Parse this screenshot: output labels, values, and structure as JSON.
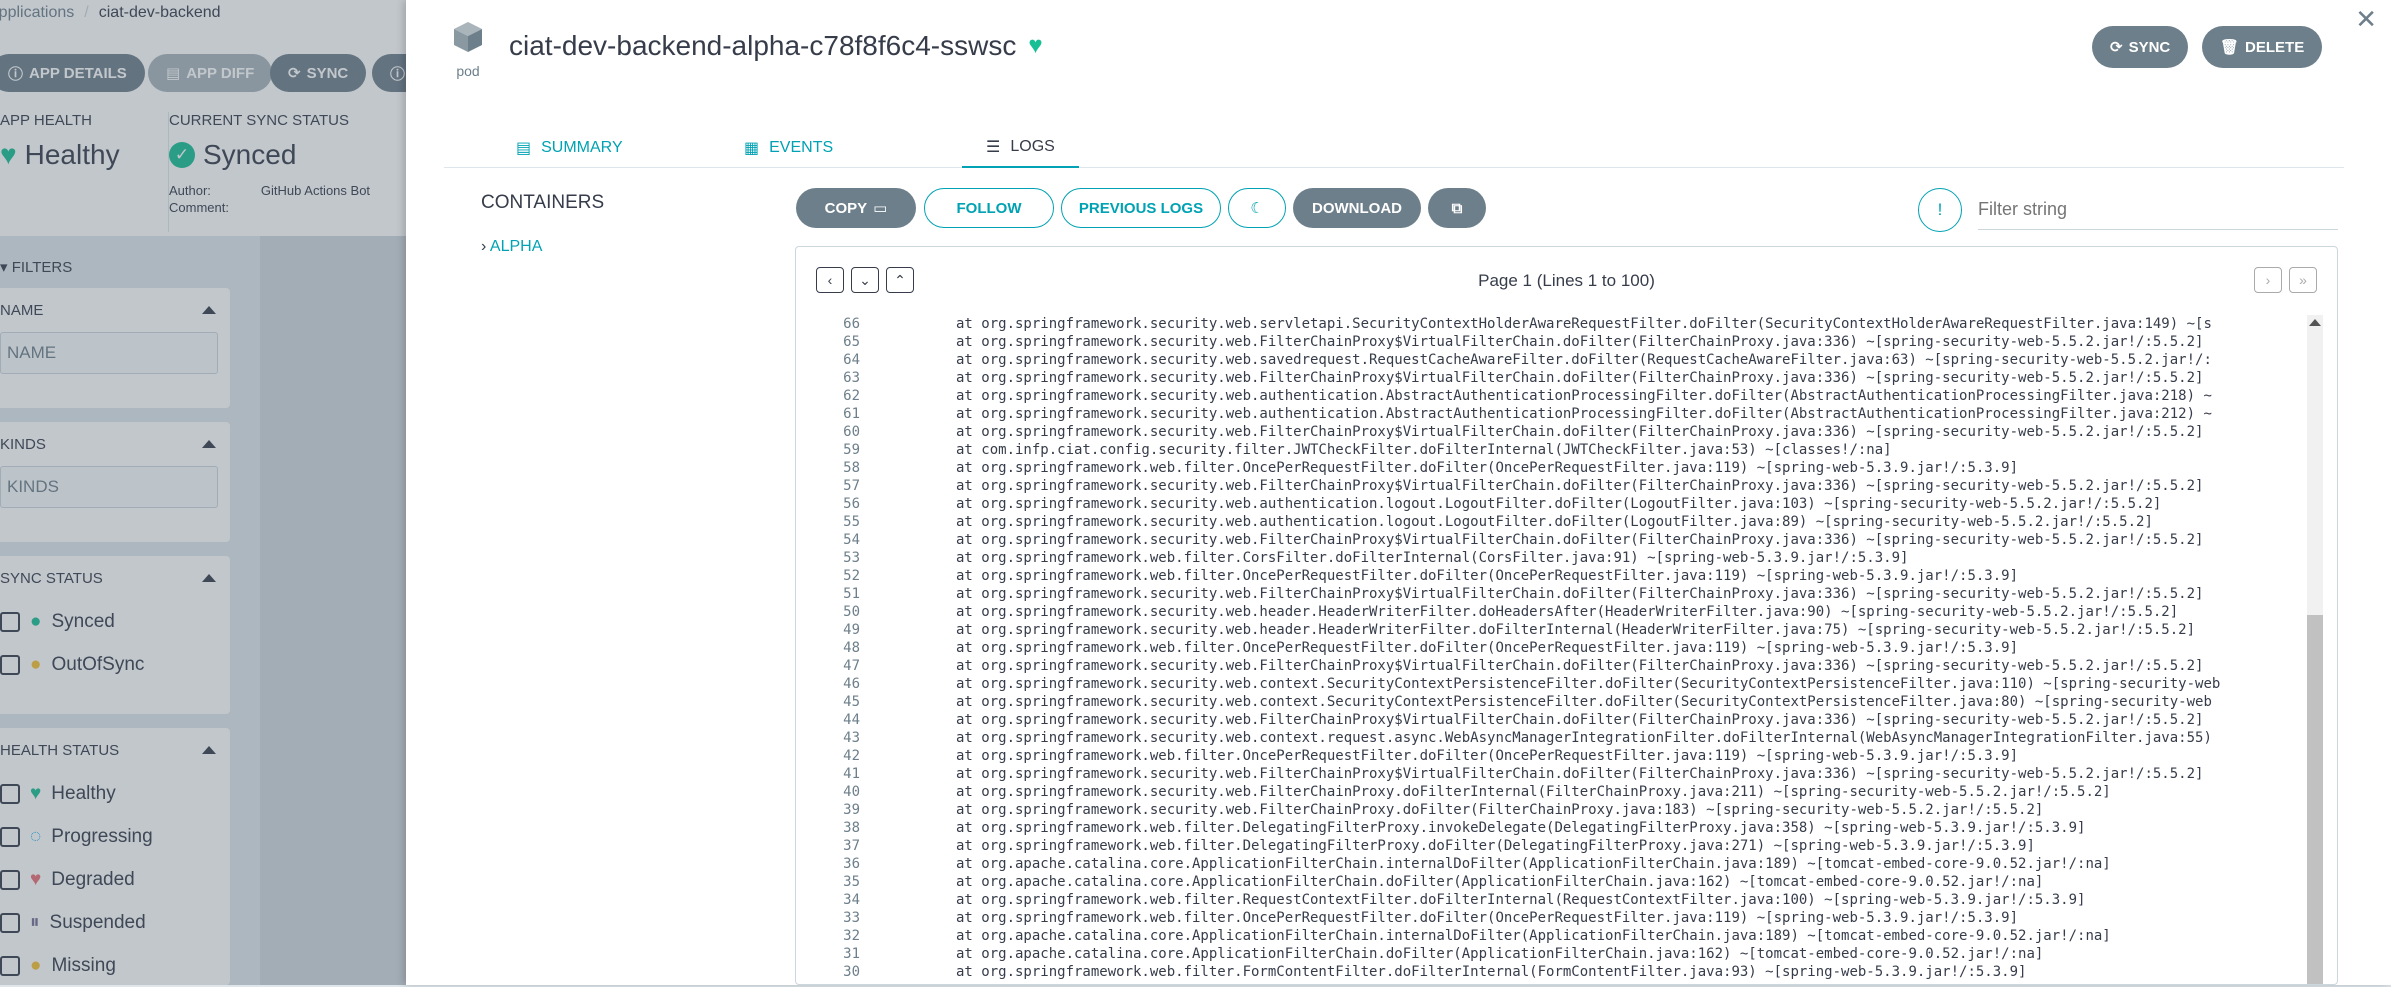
{
  "breadcrumb": {
    "root": "Applications",
    "current": "ciat-dev-backend"
  },
  "bg_toolbar": [
    {
      "label": "APP DETAILS",
      "icon": "info-icon"
    },
    {
      "label": "APP DIFF",
      "icon": "diff-icon"
    },
    {
      "label": "SYNC",
      "icon": "sync-icon"
    }
  ],
  "app_health": {
    "label": "APP HEALTH",
    "value": "Healthy"
  },
  "sync_status": {
    "label": "CURRENT SYNC STATUS",
    "value": "Synced",
    "author_label": "Author:",
    "author_value": "GitHub Actions Bot",
    "comment_label": "Comment:"
  },
  "filters": {
    "title": "FILTERS",
    "name": {
      "title": "NAME",
      "placeholder": "NAME"
    },
    "kinds": {
      "title": "KINDS",
      "placeholder": "KINDS"
    },
    "sync": {
      "title": "SYNC STATUS",
      "items": [
        "Synced",
        "OutOfSync"
      ]
    },
    "health": {
      "title": "HEALTH STATUS",
      "items": [
        "Healthy",
        "Progressing",
        "Degraded",
        "Suspended",
        "Missing"
      ]
    }
  },
  "panel": {
    "kind": "pod",
    "title": "ciat-dev-backend-alpha-c78f8f6c4-sswsc",
    "sync_label": "SYNC",
    "delete_label": "DELETE",
    "tabs": [
      "SUMMARY",
      "EVENTS",
      "LOGS"
    ],
    "containers_title": "CONTAINERS",
    "container_name": "ALPHA"
  },
  "log_toolbar": {
    "copy": "COPY",
    "follow": "FOLLOW",
    "previous": "PREVIOUS LOGS",
    "download": "DOWNLOAD",
    "filter_placeholder": "Filter string"
  },
  "pager": {
    "info": "Page 1 (Lines 1 to 100)"
  },
  "log_lines": [
    {
      "n": "66",
      "t": "at org.springframework.security.web.servletapi.SecurityContextHolderAwareRequestFilter.doFilter(SecurityContextHolderAwareRequestFilter.java:149) ~[s"
    },
    {
      "n": "65",
      "t": "at org.springframework.security.web.FilterChainProxy$VirtualFilterChain.doFilter(FilterChainProxy.java:336) ~[spring-security-web-5.5.2.jar!/:5.5.2]"
    },
    {
      "n": "64",
      "t": "at org.springframework.security.web.savedrequest.RequestCacheAwareFilter.doFilter(RequestCacheAwareFilter.java:63) ~[spring-security-web-5.5.2.jar!/:"
    },
    {
      "n": "63",
      "t": "at org.springframework.security.web.FilterChainProxy$VirtualFilterChain.doFilter(FilterChainProxy.java:336) ~[spring-security-web-5.5.2.jar!/:5.5.2]"
    },
    {
      "n": "62",
      "t": "at org.springframework.security.web.authentication.AbstractAuthenticationProcessingFilter.doFilter(AbstractAuthenticationProcessingFilter.java:218) ~"
    },
    {
      "n": "61",
      "t": "at org.springframework.security.web.authentication.AbstractAuthenticationProcessingFilter.doFilter(AbstractAuthenticationProcessingFilter.java:212) ~"
    },
    {
      "n": "60",
      "t": "at org.springframework.security.web.FilterChainProxy$VirtualFilterChain.doFilter(FilterChainProxy.java:336) ~[spring-security-web-5.5.2.jar!/:5.5.2]"
    },
    {
      "n": "59",
      "t": "at com.infp.ciat.config.security.filter.JWTCheckFilter.doFilterInternal(JWTCheckFilter.java:53) ~[classes!/:na]"
    },
    {
      "n": "58",
      "t": "at org.springframework.web.filter.OncePerRequestFilter.doFilter(OncePerRequestFilter.java:119) ~[spring-web-5.3.9.jar!/:5.3.9]"
    },
    {
      "n": "57",
      "t": "at org.springframework.security.web.FilterChainProxy$VirtualFilterChain.doFilter(FilterChainProxy.java:336) ~[spring-security-web-5.5.2.jar!/:5.5.2]"
    },
    {
      "n": "56",
      "t": "at org.springframework.security.web.authentication.logout.LogoutFilter.doFilter(LogoutFilter.java:103) ~[spring-security-web-5.5.2.jar!/:5.5.2]"
    },
    {
      "n": "55",
      "t": "at org.springframework.security.web.authentication.logout.LogoutFilter.doFilter(LogoutFilter.java:89) ~[spring-security-web-5.5.2.jar!/:5.5.2]"
    },
    {
      "n": "54",
      "t": "at org.springframework.security.web.FilterChainProxy$VirtualFilterChain.doFilter(FilterChainProxy.java:336) ~[spring-security-web-5.5.2.jar!/:5.5.2]"
    },
    {
      "n": "53",
      "t": "at org.springframework.web.filter.CorsFilter.doFilterInternal(CorsFilter.java:91) ~[spring-web-5.3.9.jar!/:5.3.9]"
    },
    {
      "n": "52",
      "t": "at org.springframework.web.filter.OncePerRequestFilter.doFilter(OncePerRequestFilter.java:119) ~[spring-web-5.3.9.jar!/:5.3.9]"
    },
    {
      "n": "51",
      "t": "at org.springframework.security.web.FilterChainProxy$VirtualFilterChain.doFilter(FilterChainProxy.java:336) ~[spring-security-web-5.5.2.jar!/:5.5.2]"
    },
    {
      "n": "50",
      "t": "at org.springframework.security.web.header.HeaderWriterFilter.doHeadersAfter(HeaderWriterFilter.java:90) ~[spring-security-web-5.5.2.jar!/:5.5.2]"
    },
    {
      "n": "49",
      "t": "at org.springframework.security.web.header.HeaderWriterFilter.doFilterInternal(HeaderWriterFilter.java:75) ~[spring-security-web-5.5.2.jar!/:5.5.2]"
    },
    {
      "n": "48",
      "t": "at org.springframework.web.filter.OncePerRequestFilter.doFilter(OncePerRequestFilter.java:119) ~[spring-web-5.3.9.jar!/:5.3.9]"
    },
    {
      "n": "47",
      "t": "at org.springframework.security.web.FilterChainProxy$VirtualFilterChain.doFilter(FilterChainProxy.java:336) ~[spring-security-web-5.5.2.jar!/:5.5.2]"
    },
    {
      "n": "46",
      "t": "at org.springframework.security.web.context.SecurityContextPersistenceFilter.doFilter(SecurityContextPersistenceFilter.java:110) ~[spring-security-web"
    },
    {
      "n": "45",
      "t": "at org.springframework.security.web.context.SecurityContextPersistenceFilter.doFilter(SecurityContextPersistenceFilter.java:80) ~[spring-security-web"
    },
    {
      "n": "44",
      "t": "at org.springframework.security.web.FilterChainProxy$VirtualFilterChain.doFilter(FilterChainProxy.java:336) ~[spring-security-web-5.5.2.jar!/:5.5.2]"
    },
    {
      "n": "43",
      "t": "at org.springframework.security.web.context.request.async.WebAsyncManagerIntegrationFilter.doFilterInternal(WebAsyncManagerIntegrationFilter.java:55)"
    },
    {
      "n": "42",
      "t": "at org.springframework.web.filter.OncePerRequestFilter.doFilter(OncePerRequestFilter.java:119) ~[spring-web-5.3.9.jar!/:5.3.9]"
    },
    {
      "n": "41",
      "t": "at org.springframework.security.web.FilterChainProxy$VirtualFilterChain.doFilter(FilterChainProxy.java:336) ~[spring-security-web-5.5.2.jar!/:5.5.2]"
    },
    {
      "n": "40",
      "t": "at org.springframework.security.web.FilterChainProxy.doFilterInternal(FilterChainProxy.java:211) ~[spring-security-web-5.5.2.jar!/:5.5.2]"
    },
    {
      "n": "39",
      "t": "at org.springframework.security.web.FilterChainProxy.doFilter(FilterChainProxy.java:183) ~[spring-security-web-5.5.2.jar!/:5.5.2]"
    },
    {
      "n": "38",
      "t": "at org.springframework.web.filter.DelegatingFilterProxy.invokeDelegate(DelegatingFilterProxy.java:358) ~[spring-web-5.3.9.jar!/:5.3.9]"
    },
    {
      "n": "37",
      "t": "at org.springframework.web.filter.DelegatingFilterProxy.doFilter(DelegatingFilterProxy.java:271) ~[spring-web-5.3.9.jar!/:5.3.9]"
    },
    {
      "n": "36",
      "t": "at org.apache.catalina.core.ApplicationFilterChain.internalDoFilter(ApplicationFilterChain.java:189) ~[tomcat-embed-core-9.0.52.jar!/:na]"
    },
    {
      "n": "35",
      "t": "at org.apache.catalina.core.ApplicationFilterChain.doFilter(ApplicationFilterChain.java:162) ~[tomcat-embed-core-9.0.52.jar!/:na]"
    },
    {
      "n": "34",
      "t": "at org.springframework.web.filter.RequestContextFilter.doFilterInternal(RequestContextFilter.java:100) ~[spring-web-5.3.9.jar!/:5.3.9]"
    },
    {
      "n": "33",
      "t": "at org.springframework.web.filter.OncePerRequestFilter.doFilter(OncePerRequestFilter.java:119) ~[spring-web-5.3.9.jar!/:5.3.9]"
    },
    {
      "n": "32",
      "t": "at org.apache.catalina.core.ApplicationFilterChain.internalDoFilter(ApplicationFilterChain.java:189) ~[tomcat-embed-core-9.0.52.jar!/:na]"
    },
    {
      "n": "31",
      "t": "at org.apache.catalina.core.ApplicationFilterChain.doFilter(ApplicationFilterChain.java:162) ~[tomcat-embed-core-9.0.52.jar!/:na]"
    },
    {
      "n": "30",
      "t": "at org.springframework.web.filter.FormContentFilter.doFilterInternal(FormContentFilter.java:93) ~[spring-web-5.3.9.jar!/:5.3.9]"
    }
  ],
  "colors": {
    "accent": "#00a2b3",
    "healthy": "#18be94",
    "button": "#6d7f8b"
  }
}
